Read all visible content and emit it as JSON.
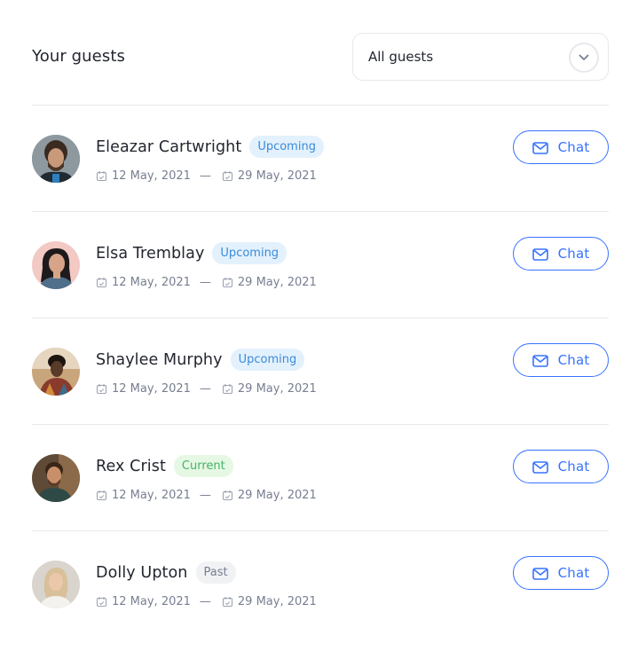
{
  "header": {
    "title": "Your guests"
  },
  "filter": {
    "value": "All guests",
    "icon": "chevron-down-icon"
  },
  "colors": {
    "accent": "#3772ff",
    "badge_upcoming_bg": "#e3f1fd",
    "badge_upcoming_text": "#3a8bd9",
    "badge_current_bg": "#e6f8e3",
    "badge_current_text": "#45b36b",
    "badge_past_bg": "#f1f2f4",
    "badge_past_text": "#777e91"
  },
  "guests": [
    {
      "name": "Eleazar Cartwright",
      "status": "Upcoming",
      "check_in": "12 May, 2021",
      "separator": "—",
      "check_out": "29 May, 2021",
      "action": "Chat"
    },
    {
      "name": "Elsa Tremblay",
      "status": "Upcoming",
      "check_in": "12 May, 2021",
      "separator": "—",
      "check_out": "29 May, 2021",
      "action": "Chat"
    },
    {
      "name": "Shaylee Murphy",
      "status": "Upcoming",
      "check_in": "12 May, 2021",
      "separator": "—",
      "check_out": "29 May, 2021",
      "action": "Chat"
    },
    {
      "name": "Rex Crist",
      "status": "Current",
      "check_in": "12 May, 2021",
      "separator": "—",
      "check_out": "29 May, 2021",
      "action": "Chat"
    },
    {
      "name": "Dolly Upton",
      "status": "Past",
      "check_in": "12 May, 2021",
      "separator": "—",
      "check_out": "29 May, 2021",
      "action": "Chat"
    }
  ]
}
